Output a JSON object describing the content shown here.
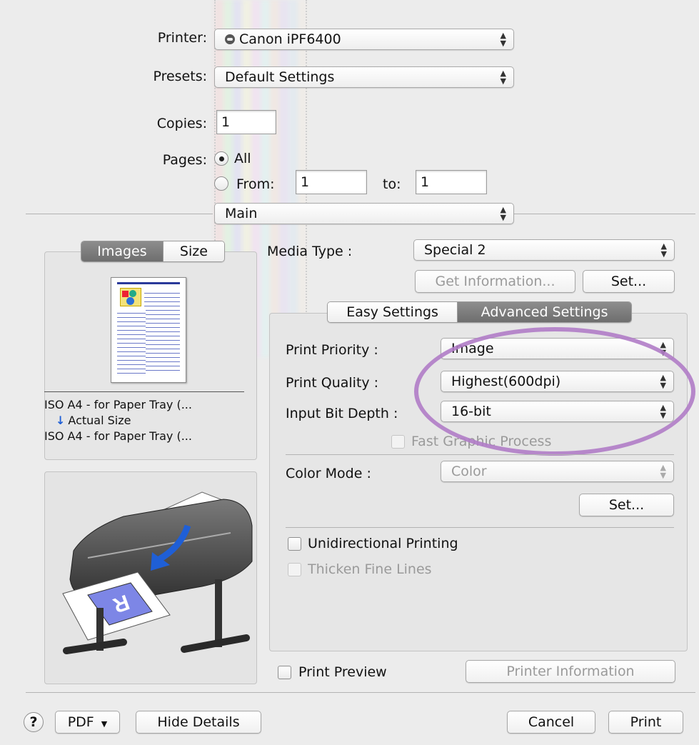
{
  "top": {
    "printer_label": "Printer:",
    "printer_value": "Canon iPF6400",
    "presets_label": "Presets:",
    "presets_value": "Default Settings",
    "copies_label": "Copies:",
    "copies_value": "1",
    "pages_label": "Pages:",
    "pages_all": "All",
    "pages_from": "From:",
    "pages_from_value": "1",
    "pages_to": "to:",
    "pages_to_value": "1",
    "section_value": "Main"
  },
  "left_panel": {
    "tabs": [
      {
        "label": "Images",
        "selected": true
      },
      {
        "label": "Size",
        "selected": false
      }
    ],
    "paper_from": "ISO A4 - for Paper Tray (...",
    "scale_label": "Actual Size",
    "paper_to": "ISO A4 - for Paper Tray (..."
  },
  "media": {
    "label": "Media Type :",
    "value": "Special 2",
    "get_info_button": "Get Information...",
    "set_button": "Set..."
  },
  "settings_tabs": [
    {
      "label": "Easy Settings",
      "selected": false
    },
    {
      "label": "Advanced Settings",
      "selected": true
    }
  ],
  "advanced": {
    "print_priority_label": "Print Priority :",
    "print_priority_value": "Image",
    "print_quality_label": "Print Quality :",
    "print_quality_value": "Highest(600dpi)",
    "bit_depth_label": "Input Bit Depth :",
    "bit_depth_value": "16-bit",
    "fast_graphic": "Fast Graphic Process",
    "color_mode_label": "Color Mode :",
    "color_mode_value": "Color",
    "color_set_button": "Set...",
    "unidirectional": "Unidirectional Printing",
    "thicken": "Thicken Fine Lines"
  },
  "preview_row": {
    "print_preview": "Print Preview",
    "printer_info_button": "Printer Information"
  },
  "bottom": {
    "help": "?",
    "pdf_button": "PDF",
    "hide_details_button": "Hide Details",
    "cancel_button": "Cancel",
    "print_button": "Print"
  },
  "colors": {
    "highlight_ellipse": "#b07cc6",
    "tab_selected": "#7b7b7b",
    "arrow_blue": "#1f5fd6"
  }
}
